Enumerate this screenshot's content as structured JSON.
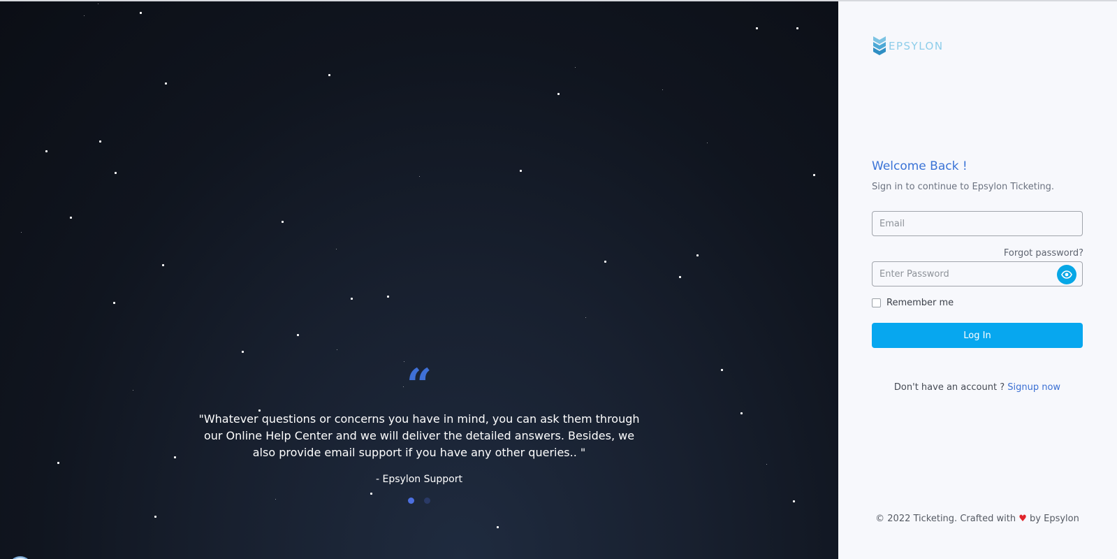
{
  "brand": {
    "name": "EPSYLON",
    "logo_icon": "chevron-stack-icon",
    "color": "#8dcdea"
  },
  "testimonial": {
    "quote_icon": "“",
    "text": "\"Whatever questions or concerns you have in mind, you can ask them through our Online Help Center and we will deliver the detailed answers. Besides, we also provide email support if you have any other queries.. \"",
    "author": "- Epsylon Support",
    "slides": 2,
    "active_slide": 1
  },
  "login": {
    "title": "Welcome Back !",
    "subtitle": "Sign in to continue to Epsylon Ticketing.",
    "email_placeholder": "Email",
    "email_value": "",
    "forgot_label": "Forgot password?",
    "password_placeholder": "Enter Password",
    "password_value": "",
    "remember_label": "Remember me",
    "remember_checked": false,
    "submit_label": "Log In",
    "signup_prompt": "Don't have an account ? ",
    "signup_link": "Signup now"
  },
  "footer": {
    "prefix": "© 2022 Ticketing. Crafted with ",
    "heart": "♥",
    "suffix": " by Epsylon"
  },
  "colors": {
    "accent": "#07a7ef",
    "title": "#3a73d6",
    "link": "#3a6fd3",
    "quote_icon": "#3f70d6"
  }
}
